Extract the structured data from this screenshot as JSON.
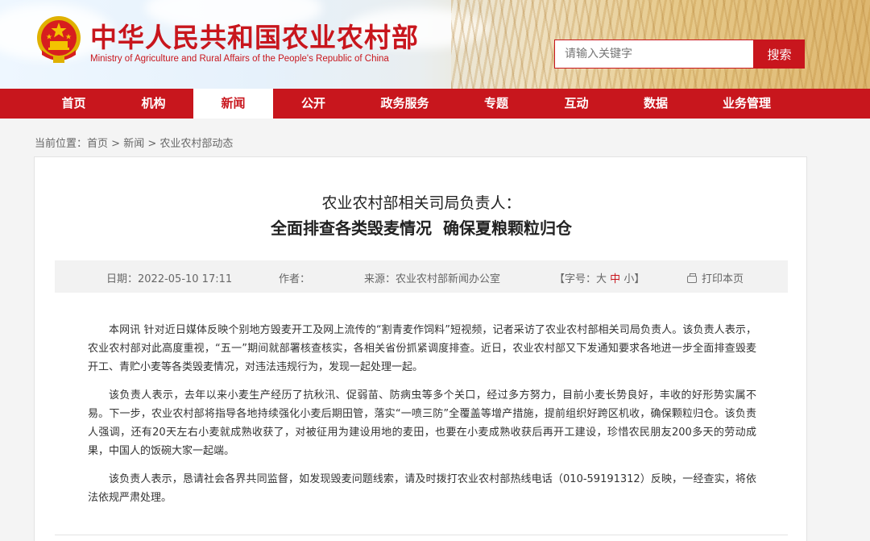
{
  "header": {
    "title": "中华人民共和国农业农村部",
    "subtitle": "Ministry of Agriculture and Rural Affairs of the People's Republic of China",
    "search_placeholder": "请输入关键字",
    "search_button": "搜索"
  },
  "nav": {
    "items": [
      "首页",
      "机构",
      "新闻",
      "公开",
      "政务服务",
      "专题",
      "互动",
      "数据",
      "业务管理"
    ],
    "active": "新闻"
  },
  "breadcrumb": {
    "prefix": "当前位置：",
    "home": "首页",
    "sep": " > ",
    "news": "新闻",
    "current": "农业农村部动态"
  },
  "article": {
    "title_line1": "农业农村部相关司局负责人：",
    "title_line2": "全面排查各类毁麦情况  确保夏粮颗粒归仓",
    "date": "日期：2022-05-10 17:11",
    "author": "作者：",
    "source": "来源：农业农村部新闻办公室",
    "font_size_open": "【字号：",
    "font_large": "大",
    "font_medium": "中",
    "font_small": "小",
    "font_size_close": "】",
    "print": "打印本页",
    "paragraphs": [
      "本网讯 针对近日媒体反映个别地方毁麦开工及网上流传的“割青麦作饲料”短视频，记者采访了农业农村部相关司局负责人。该负责人表示，农业农村部对此高度重视，“五一”期间就部署核查核实，各相关省份抓紧调度排查。近日，农业农村部又下发通知要求各地进一步全面排查毁麦开工、青贮小麦等各类毁麦情况，对违法违规行为，发现一起处理一起。",
      "该负责人表示，去年以来小麦生产经历了抗秋汛、促弱苗、防病虫等多个关口，经过多方努力，目前小麦长势良好，丰收的好形势实属不易。下一步，农业农村部将指导各地持续强化小麦后期田管，落实“一喷三防”全覆盖等增产措施，提前组织好跨区机收，确保颗粒归仓。该负责人强调，还有20天左右小麦就成熟收获了，对被征用为建设用地的麦田，也要在小麦成熟收获后再开工建设，珍惜农民朋友200多天的劳动成果，中国人的饭碗大家一起端。",
      "该负责人表示，恳请社会各界共同监督，如发现毁麦问题线索，请及时拨打农业农村部热线电话（010-59191312）反映，一经查实，将依法依规严肃处理。"
    ]
  },
  "colors": {
    "brand_red": "#c8161d",
    "meta_bg": "#f2f2f2"
  },
  "icons": [
    "national-emblem-icon",
    "printer-icon"
  ]
}
